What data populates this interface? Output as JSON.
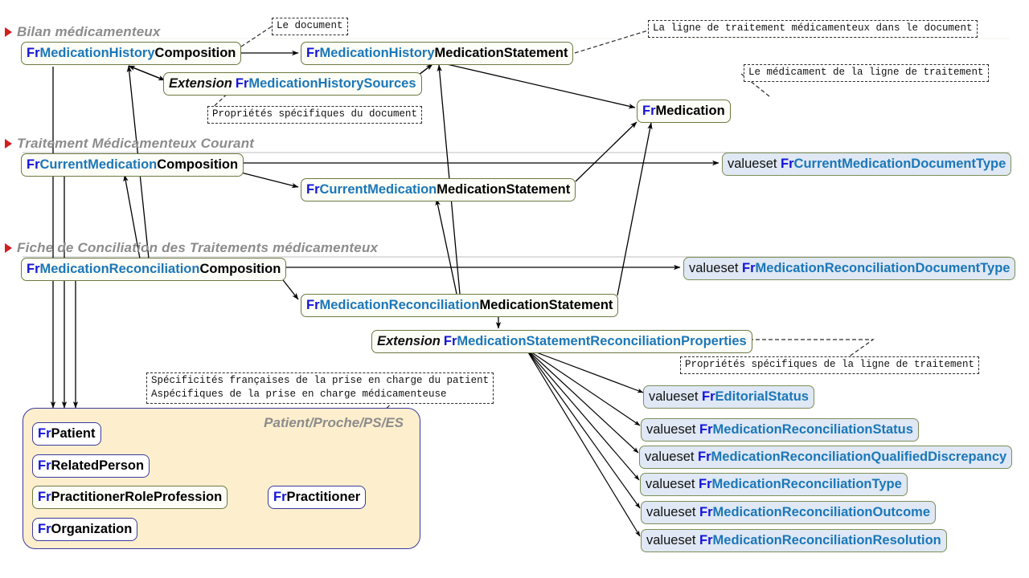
{
  "diagram": {
    "title": "FHIR FR profiles medication diagram",
    "colors": {
      "prefix_blue": "#1414d8",
      "mid_blue": "#1b77b8",
      "node_border": "#6b7a42",
      "valueset_fill": "#dfe8f4",
      "group_fill": "#fdeecd",
      "group_border": "#3a3a9e",
      "bullet_red": "#cf1f1f",
      "section_gray": "#8c8c8c"
    },
    "sections": [
      {
        "bullet": "triangle-right-icon",
        "label": "Bilan médicamenteux"
      },
      {
        "bullet": "triangle-right-icon",
        "label": "Traitement Médicamenteux Courant"
      },
      {
        "bullet": "triangle-right-icon",
        "label": "Fiche de Conciliation des Traitements médicamenteux"
      }
    ],
    "nodes": {
      "history_composition": {
        "fr": "Fr",
        "mid": "MedicationHistory",
        "tail": "Composition"
      },
      "history_statement": {
        "fr": "Fr",
        "mid": "MedicationHistory",
        "tail": "MedicationStatement"
      },
      "history_sources_ext": {
        "ext": "Extension",
        "fr": "Fr",
        "mid": "MedicationHistorySources",
        "tail": ""
      },
      "medication": {
        "fr": "Fr",
        "mid": "",
        "tail": "Medication"
      },
      "current_composition": {
        "fr": "Fr",
        "mid": "CurrentMedication",
        "tail": "Composition"
      },
      "current_statement": {
        "fr": "Fr",
        "mid": "CurrentMedication",
        "tail": "MedicationStatement"
      },
      "reconciliation_composition": {
        "fr": "Fr",
        "mid": "MedicationReconciliation",
        "tail": "Composition"
      },
      "reconciliation_statement": {
        "fr": "Fr",
        "mid": "MedicationReconciliation",
        "tail": "MedicationStatement"
      },
      "reconciliation_props_ext": {
        "ext": "Extension",
        "fr": "Fr",
        "mid": "MedicationStatementReconciliationProperties",
        "tail": ""
      }
    },
    "valuesets": {
      "current_doc_type": {
        "vs": "valueset ",
        "fr": "Fr",
        "mid": "CurrentMedicationDocumentType"
      },
      "reconciliation_doc_type": {
        "vs": "valueset ",
        "fr": "Fr",
        "mid": "MedicationReconciliationDocumentType"
      },
      "editorial_status": {
        "vs": "valueset ",
        "fr": "Fr",
        "mid": "EditorialStatus"
      },
      "reco_status": {
        "vs": "valueset ",
        "fr": "Fr",
        "mid": "MedicationReconciliationStatus"
      },
      "reco_qualified_discrepancy": {
        "vs": "valueset ",
        "fr": "Fr",
        "mid": "MedicationReconciliationQualifiedDiscrepancy"
      },
      "reco_type": {
        "vs": "valueset ",
        "fr": "Fr",
        "mid": "MedicationReconciliationType"
      },
      "reco_outcome": {
        "vs": "valueset ",
        "fr": "Fr",
        "mid": "MedicationReconciliationOutcome"
      },
      "reco_resolution": {
        "vs": "valueset ",
        "fr": "Fr",
        "mid": "MedicationReconciliationResolution"
      }
    },
    "notes": {
      "document": "Le document",
      "treatment_line": "La ligne de traitement médicamenteux dans le document",
      "doc_properties": "Propriétés spécifiques du document",
      "medication_line": "Le médicament de la ligne de traitement",
      "line_properties": "Propriétés spécifiques de la ligne de traitement",
      "patient_note": "Spécificités françaises de la prise en charge du patient\nAspécifiques de la prise en charge médicamenteuse"
    },
    "patient_group": {
      "title": "Patient/Proche/PS/ES",
      "members": [
        {
          "fr": "Fr",
          "tail": "Patient"
        },
        {
          "fr": "Fr",
          "tail": "RelatedPerson"
        },
        {
          "fr": "Fr",
          "tail": "PractitionerRoleProfession"
        },
        {
          "fr": "Fr",
          "tail": "Practitioner"
        },
        {
          "fr": "Fr",
          "tail": "Organization"
        }
      ]
    }
  }
}
